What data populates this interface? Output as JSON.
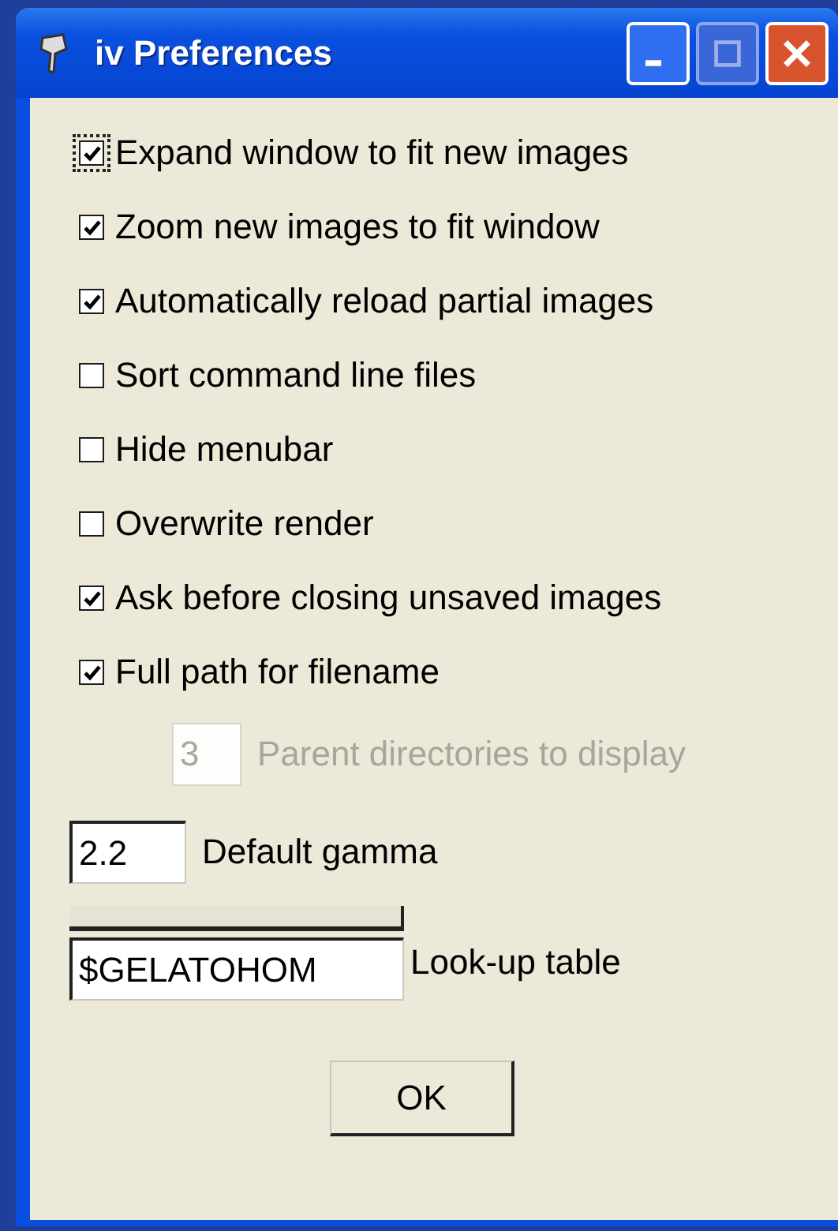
{
  "window": {
    "title": "iv Preferences"
  },
  "options": [
    {
      "label": "Expand window to fit new images",
      "checked": true,
      "focused": true
    },
    {
      "label": "Zoom new images to fit window",
      "checked": true,
      "focused": false
    },
    {
      "label": "Automatically reload partial images",
      "checked": true,
      "focused": false
    },
    {
      "label": "Sort command line files",
      "checked": false,
      "focused": false
    },
    {
      "label": "Hide menubar",
      "checked": false,
      "focused": false
    },
    {
      "label": "Overwrite render",
      "checked": false,
      "focused": false
    },
    {
      "label": "Ask before closing unsaved images",
      "checked": true,
      "focused": false
    },
    {
      "label": "Full path for filename",
      "checked": true,
      "focused": false
    }
  ],
  "parent_dirs": {
    "value": "3",
    "label": "Parent directories to display",
    "disabled": true
  },
  "gamma": {
    "value": "2.2",
    "label": "Default gamma"
  },
  "lookup_table": {
    "value": "$GELATOHOM",
    "label": "Look-up table"
  },
  "buttons": [
    "OK"
  ]
}
